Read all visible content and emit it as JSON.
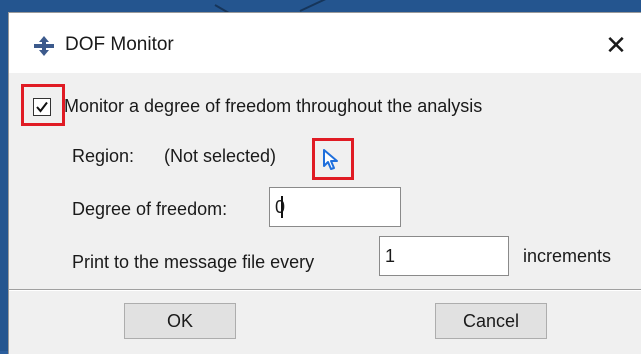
{
  "window": {
    "title": "DOF Monitor",
    "close_glyph": "✕",
    "icon": "dof-monitor-icon"
  },
  "monitor_checkbox": {
    "checked": true,
    "label": "Monitor a degree of freedom throughout the analysis"
  },
  "region": {
    "label": "Region:",
    "value": "(Not selected)",
    "select_icon": "pointer-arrow-icon"
  },
  "dof": {
    "label": "Degree of freedom:",
    "value": "0"
  },
  "print": {
    "label": "Print to the message file every",
    "value": "1",
    "suffix": "increments"
  },
  "buttons": {
    "ok": "OK",
    "cancel": "Cancel"
  },
  "colors": {
    "highlight": "#e01b24",
    "selector_blue": "#1f6fdc"
  }
}
